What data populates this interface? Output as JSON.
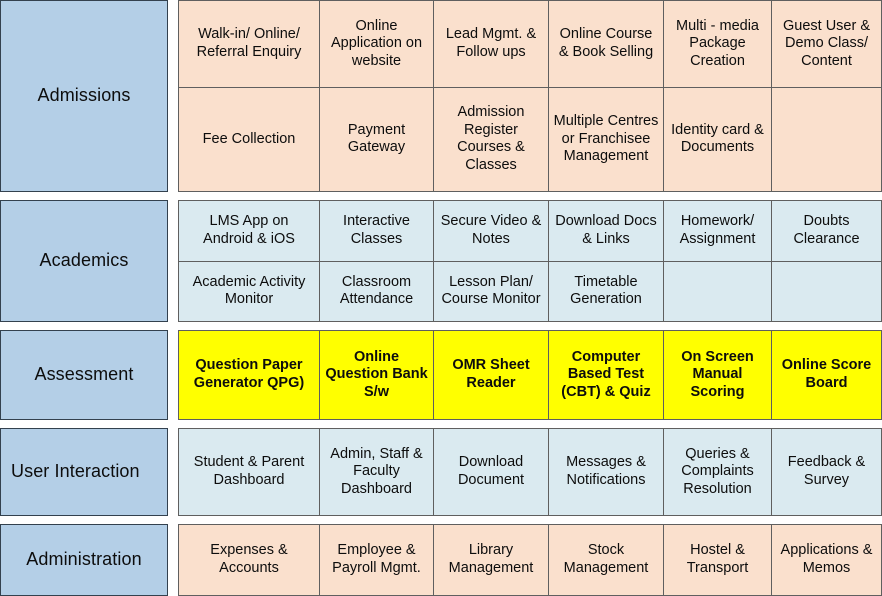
{
  "colors": {
    "category_fill": "#b4cfe7",
    "category_border": "#33414e",
    "cell_border": "#5f5f5f",
    "admissions_fill": "#fae0cd",
    "academics_fill": "#daeaf0",
    "assessment_fill": "#ffff00",
    "user_interaction_fill": "#daeaf0",
    "administration_fill": "#fae0cd",
    "text": "#0d0d0d",
    "page_background": "#ffffff"
  },
  "bands": [
    {
      "category": "Admissions",
      "category_align": "center",
      "theme": "peach",
      "rows": [
        [
          "Walk-in/ Online/  Referral Enquiry",
          "Online Application on website",
          "Lead Mgmt. & Follow ups",
          "Online Course & Book Selling",
          "Multi - media Package Creation",
          "Guest User & Demo Class/ Content"
        ],
        [
          "Fee Collection",
          "Payment Gateway",
          "Admission Register Courses & Classes",
          "Multiple Centres or Franchisee Management",
          "Identity card & Documents",
          ""
        ]
      ]
    },
    {
      "category": "Academics",
      "category_align": "center",
      "theme": "blue",
      "rows": [
        [
          "LMS App on Android & iOS",
          "Interactive Classes",
          "Secure Video & Notes",
          "Download Docs & Links",
          "Homework/ Assignment",
          "Doubts Clearance"
        ],
        [
          "Academic Activity Monitor",
          "Classroom Attendance",
          "Lesson Plan/ Course Monitor",
          "Timetable Generation",
          "",
          ""
        ]
      ]
    },
    {
      "category": "Assessment",
      "category_align": "center",
      "theme": "yellow",
      "rows": [
        [
          "Question Paper Generator QPG)",
          "Online Question Bank S/w",
          "OMR Sheet Reader",
          "Computer Based Test (CBT) & Quiz",
          "On Screen Manual Scoring",
          "Online Score Board"
        ]
      ]
    },
    {
      "category": "User Interaction",
      "category_align": "left",
      "theme": "blue",
      "rows": [
        [
          "Student & Parent Dashboard",
          "Admin, Staff & Faculty Dashboard",
          "Download Document",
          "Messages & Notifications",
          "Queries & Complaints Resolution",
          "Feedback & Survey"
        ]
      ]
    },
    {
      "category": "Administration",
      "category_align": "center",
      "theme": "peach",
      "rows": [
        [
          "Expenses & Accounts",
          "Employee & Payroll Mgmt.",
          "Library Management",
          "Stock Management",
          "Hostel & Transport",
          "Applications & Memos"
        ]
      ]
    }
  ]
}
